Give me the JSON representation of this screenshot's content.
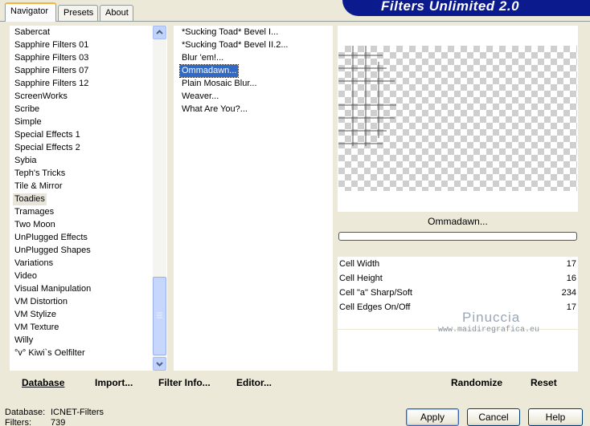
{
  "tabs": [
    "Navigator",
    "Presets",
    "About"
  ],
  "banner": "Filters Unlimited 2.0",
  "categories": [
    "Sabercat",
    "Sapphire Filters 01",
    "Sapphire Filters 03",
    "Sapphire Filters 07",
    "Sapphire Filters 12",
    "ScreenWorks",
    "Scribe",
    "Simple",
    "Special Effects 1",
    "Special Effects 2",
    "Sybia",
    "Teph's Tricks",
    "Tile & Mirror",
    "Toadies",
    "Tramages",
    "Two Moon",
    "UnPlugged Effects",
    "UnPlugged Shapes",
    "Variations",
    "Video",
    "Visual Manipulation",
    "VM Distortion",
    "VM Stylize",
    "VM Texture",
    "Willy",
    "°v° Kiwi`s Oelfilter"
  ],
  "filters": [
    "*Sucking Toad*  Bevel I...",
    "*Sucking Toad*  Bevel II.2...",
    "Blur 'em!...",
    "Ommadawn...",
    "Plain Mosaic Blur...",
    "Weaver...",
    "What Are You?..."
  ],
  "filter_name": "Ommadawn...",
  "params": [
    {
      "label": "Cell Width",
      "value": "17"
    },
    {
      "label": "Cell Height",
      "value": "16"
    },
    {
      "label": "Cell \"a\" Sharp/Soft",
      "value": "234"
    },
    {
      "label": "Cell Edges On/Off",
      "value": "17"
    }
  ],
  "watermark": {
    "name": "Pinuccia",
    "site": "www.maidiregrafica.eu"
  },
  "buttons": {
    "database": "Database",
    "import": "Import...",
    "filter_info": "Filter Info...",
    "editor": "Editor...",
    "randomize": "Randomize",
    "reset": "Reset",
    "apply": "Apply",
    "cancel": "Cancel",
    "help": "Help"
  },
  "status": {
    "database_label": "Database:",
    "database_value": "ICNET-Filters",
    "filters_label": "Filters:",
    "filters_value": "739"
  }
}
